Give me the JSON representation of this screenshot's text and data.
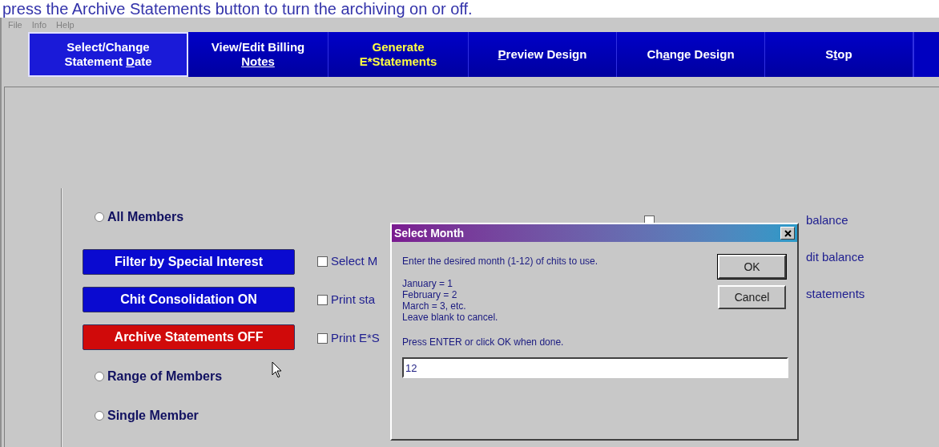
{
  "caption": "press the Archive Statements button to turn the archiving on or off.",
  "menu": [
    "File",
    "Info",
    "Help"
  ],
  "toolbar": [
    {
      "lines": [
        [
          {
            "text": "Select/Change",
            "underlined": false
          }
        ],
        [
          {
            "text": "Statement ",
            "underlined": false
          },
          {
            "text": "D",
            "underlined": true
          },
          {
            "text": "ate",
            "underlined": false
          }
        ]
      ],
      "selected": true,
      "highlight": false
    },
    {
      "lines": [
        [
          {
            "text": "View/Edit Billing",
            "underlined": false
          }
        ],
        [
          {
            "text": "Notes",
            "underlined": true
          }
        ]
      ],
      "selected": false,
      "highlight": false
    },
    {
      "lines": [
        [
          {
            "text": "Generate",
            "underlined": false
          }
        ],
        [
          {
            "text": "E*Statements",
            "underlined": false
          }
        ]
      ],
      "selected": false,
      "highlight": true
    },
    {
      "lines": [
        [
          {
            "text": "P",
            "underlined": true
          },
          {
            "text": "review Design",
            "underlined": false
          }
        ]
      ],
      "selected": false,
      "highlight": false
    },
    {
      "lines": [
        [
          {
            "text": "Ch",
            "underlined": false
          },
          {
            "text": "a",
            "underlined": true
          },
          {
            "text": "nge Design",
            "underlined": false
          }
        ]
      ],
      "selected": false,
      "highlight": false
    },
    {
      "lines": [
        [
          {
            "text": "S",
            "underlined": false
          },
          {
            "text": "t",
            "underlined": true
          },
          {
            "text": "op",
            "underlined": false
          }
        ]
      ],
      "selected": false,
      "highlight": false
    }
  ],
  "members_radios": [
    {
      "label": "All Members",
      "selected": false
    },
    {
      "label": "Range of Members",
      "selected": false
    },
    {
      "label": "Single Member",
      "selected": false
    }
  ],
  "action_buttons": [
    {
      "label": "Filter by Special Interest",
      "color": "#0a0ad0"
    },
    {
      "label": "Chit Consolidation ON",
      "color": "#0a0ad0"
    },
    {
      "label": "Archive Statements OFF",
      "color": "#d00a0a"
    }
  ],
  "options_left": [
    {
      "label": "Select M",
      "checked": false
    },
    {
      "label": "Print sta",
      "checked": false
    },
    {
      "label": "Print E*S",
      "checked": false
    }
  ],
  "options_right": [
    {
      "label": "balance",
      "checked": false
    },
    {
      "label": "dit balance"
    },
    {
      "label": "statements"
    }
  ],
  "dialog": {
    "title": "Select Month",
    "prompt": "Enter the desired month (1-12) of chits to use.",
    "lines": [
      "January = 1",
      "February = 2",
      "March = 3, etc.",
      "Leave blank to cancel."
    ],
    "hint": "Press ENTER or click OK when done.",
    "value": "12",
    "buttons": [
      "OK",
      "Cancel"
    ]
  }
}
